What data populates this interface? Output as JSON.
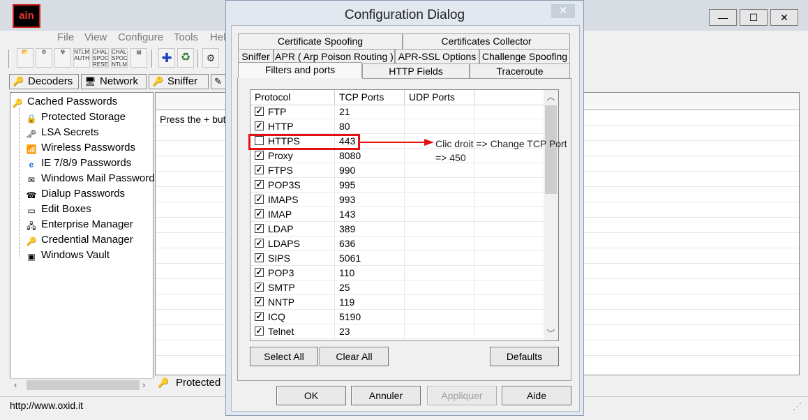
{
  "app": {
    "icon_text": "ain",
    "window_buttons": {
      "minimize": "—",
      "maximize": "☐",
      "close": "✕"
    },
    "menu": [
      "File",
      "View",
      "Configure",
      "Tools",
      "Hel"
    ],
    "toolbar_items": [
      {
        "name": "open-icon",
        "label": "📂"
      },
      {
        "name": "network-icon",
        "label": "⚙"
      },
      {
        "name": "radioactive-icon",
        "label": "☢"
      },
      {
        "name": "ntlm-auth-icon",
        "label": "NTLM AUTH"
      },
      {
        "name": "chall-spoof-reset-icon",
        "label": "CHALL SPOOF RESET"
      },
      {
        "name": "chall-spoof-ntlm-icon",
        "label": "CHALL SPOOF NTLM"
      },
      {
        "name": "console-icon",
        "label": "▤"
      },
      {
        "name": "add-icon",
        "label": "✚"
      },
      {
        "name": "recycle-icon",
        "label": "♻"
      },
      {
        "name": "config-icon",
        "label": "⚙"
      }
    ],
    "main_tabs": [
      {
        "label": "Decoders",
        "icon": "🔑"
      },
      {
        "label": "Network",
        "icon": "🖥"
      },
      {
        "label": "Sniffer",
        "icon": "🔑"
      },
      {
        "label": "",
        "icon": "✎"
      }
    ],
    "tree": {
      "root": "Cached Passwords",
      "items": [
        {
          "label": "Protected Storage",
          "icon": "lock-icon"
        },
        {
          "label": "LSA Secrets",
          "icon": "key-icon"
        },
        {
          "label": "Wireless Passwords",
          "icon": "wireless-icon"
        },
        {
          "label": "IE 7/8/9 Passwords",
          "icon": "ie-icon"
        },
        {
          "label": "Windows Mail Passwords",
          "icon": "mail-icon"
        },
        {
          "label": "Dialup Passwords",
          "icon": "phone-icon"
        },
        {
          "label": "Edit Boxes",
          "icon": "editbox-icon"
        },
        {
          "label": "Enterprise Manager",
          "icon": "server-icon"
        },
        {
          "label": "Credential Manager",
          "icon": "credential-icon"
        },
        {
          "label": "Windows Vault",
          "icon": "vault-icon"
        }
      ]
    },
    "right_panel_text": "Press the + but",
    "bottom_tab_label": "Protected",
    "status_text": "http://www.oxid.it"
  },
  "dialog": {
    "title": "Configuration Dialog",
    "close_label": "✕",
    "tabs_row1": [
      "Certificate Spoofing",
      "Certificates Collector"
    ],
    "tabs_row2": [
      "Sniffer",
      "APR ( Arp Poison Routing )",
      "APR-SSL Options",
      "Challenge Spoofing"
    ],
    "tabs_row3": [
      "Filters and ports",
      "HTTP Fields",
      "Traceroute"
    ],
    "active_tab": "Filters and ports",
    "columns": [
      "Protocol",
      "TCP Ports",
      "UDP Ports"
    ],
    "rows": [
      {
        "protocol": "FTP",
        "tcp": "21",
        "udp": "",
        "checked": true
      },
      {
        "protocol": "HTTP",
        "tcp": "80",
        "udp": "",
        "checked": true
      },
      {
        "protocol": "HTTPS",
        "tcp": "443",
        "udp": "",
        "checked": false
      },
      {
        "protocol": "Proxy",
        "tcp": "8080",
        "udp": "",
        "checked": true
      },
      {
        "protocol": "FTPS",
        "tcp": "990",
        "udp": "",
        "checked": true
      },
      {
        "protocol": "POP3S",
        "tcp": "995",
        "udp": "",
        "checked": true
      },
      {
        "protocol": "IMAPS",
        "tcp": "993",
        "udp": "",
        "checked": true
      },
      {
        "protocol": "IMAP",
        "tcp": "143",
        "udp": "",
        "checked": true
      },
      {
        "protocol": "LDAP",
        "tcp": "389",
        "udp": "",
        "checked": true
      },
      {
        "protocol": "LDAPS",
        "tcp": "636",
        "udp": "",
        "checked": true
      },
      {
        "protocol": "SIPS",
        "tcp": "5061",
        "udp": "",
        "checked": true
      },
      {
        "protocol": "POP3",
        "tcp": "110",
        "udp": "",
        "checked": true
      },
      {
        "protocol": "SMTP",
        "tcp": "25",
        "udp": "",
        "checked": true
      },
      {
        "protocol": "NNTP",
        "tcp": "119",
        "udp": "",
        "checked": true
      },
      {
        "protocol": "ICQ",
        "tcp": "5190",
        "udp": "",
        "checked": true
      },
      {
        "protocol": "Telnet",
        "tcp": "23",
        "udp": "",
        "checked": true
      }
    ],
    "buttons": {
      "select_all": "Select All",
      "clear_all": "Clear All",
      "defaults": "Defaults",
      "ok": "OK",
      "cancel": "Annuler",
      "apply": "Appliquer",
      "help": "Aide"
    },
    "annotation": {
      "line1": "Clic droit => Change TCP Port",
      "line2": "=> 450",
      "color": "#e21212"
    }
  }
}
